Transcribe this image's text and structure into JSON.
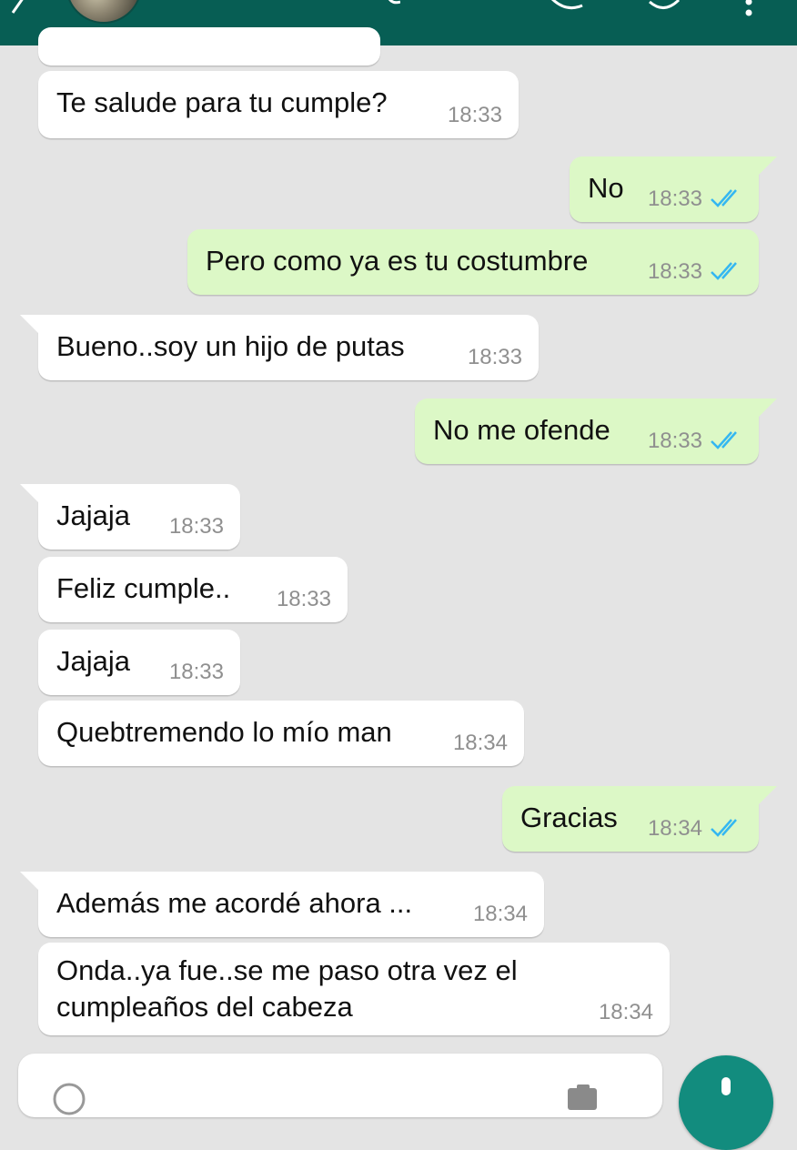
{
  "header": {
    "back_icon": "arrow-left-icon",
    "avatar": "contact-avatar",
    "icons": [
      "video-call-icon",
      "phone-icon",
      "more-vert-icon"
    ],
    "bar_color": "#075e54"
  },
  "colors": {
    "incoming_bubble": "#ffffff",
    "outgoing_bubble": "#dcf8c6",
    "read_ticks": "#34b7f1",
    "background": "#e4e4e4"
  },
  "messages": [
    {
      "dir": "in",
      "text": "Te salude para tu cumple?",
      "time": "18:33"
    },
    {
      "dir": "out",
      "text": "No",
      "time": "18:33",
      "status": "read"
    },
    {
      "dir": "out",
      "text": "Pero como ya es tu costumbre",
      "time": "18:33",
      "status": "read"
    },
    {
      "dir": "in",
      "text": "Bueno..soy un hijo de putas",
      "time": "18:33"
    },
    {
      "dir": "out",
      "text": "No me ofende",
      "time": "18:33",
      "status": "read"
    },
    {
      "dir": "in",
      "text": "Jajaja",
      "time": "18:33"
    },
    {
      "dir": "in",
      "text": "Feliz cumple..",
      "time": "18:33"
    },
    {
      "dir": "in",
      "text": "Jajaja",
      "time": "18:33"
    },
    {
      "dir": "in",
      "text": "Quebtremendo lo mío man",
      "time": "18:34"
    },
    {
      "dir": "out",
      "text": "Gracias",
      "time": "18:34",
      "status": "read"
    },
    {
      "dir": "in",
      "text": "Además me acordé ahora ...",
      "time": "18:34"
    },
    {
      "dir": "in",
      "text": "Onda..ya fue..se me paso otra vez el",
      "text2": "cumpleaños del cabeza",
      "time": "18:34"
    }
  ],
  "composer": {
    "emoji_icon": "emoji-icon",
    "attach_icon": "attach-icon",
    "send_icon": "mic-icon"
  }
}
